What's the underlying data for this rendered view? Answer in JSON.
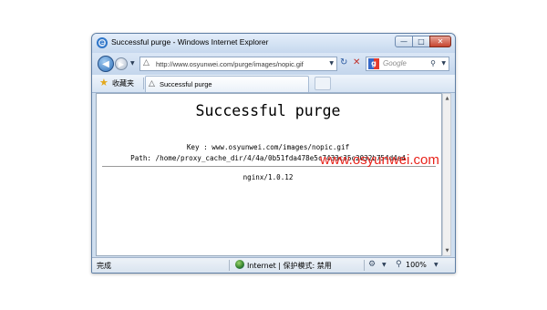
{
  "window": {
    "title": "Successful purge - Windows Internet Explorer"
  },
  "nav": {
    "address": "http://www.osyunwei.com/purge/images/nopic.gif",
    "search_placeholder": "Google"
  },
  "favorites": {
    "label": "收藏夹"
  },
  "tab": {
    "label": "Successful purge"
  },
  "page": {
    "heading": "Successful purge",
    "key_line": "Key : www.osyunwei.com/images/nopic.gif",
    "path_line": "Path: /home/proxy_cache_dir/4/4a/0b51fda478e5c7433c35c2032b754d4a4",
    "server": "nginx/1.0.12"
  },
  "status": {
    "left": "完成",
    "zone": "Internet | 保护模式: 禁用",
    "zoom": "100%"
  },
  "watermark": "www.osyunwei.com",
  "icons": {
    "browser": "ie-icon",
    "back": "back-arrow-icon",
    "forward": "forward-arrow-icon",
    "refresh": "refresh-icon",
    "stop": "stop-icon",
    "search_provider": "google-icon",
    "favorites": "star-icon",
    "zone": "globe-icon"
  },
  "colors": {
    "watermark": "#e8231b",
    "chrome": "#cfdeef"
  }
}
